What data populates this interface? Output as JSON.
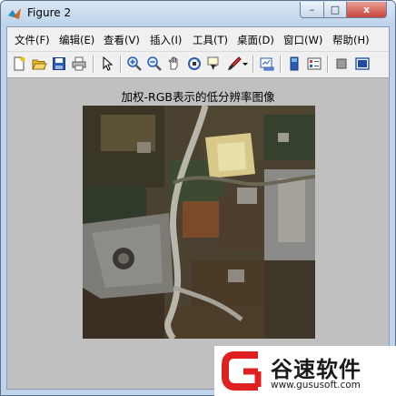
{
  "window": {
    "title": "Figure 2",
    "controls": {
      "minimize": "–",
      "maximize": "□",
      "close": "x"
    }
  },
  "menu": [
    {
      "label": "文件(F)"
    },
    {
      "label": "编辑(E)"
    },
    {
      "label": "查看(V)"
    },
    {
      "label": "插入(I)"
    },
    {
      "label": "工具(T)"
    },
    {
      "label": "桌面(D)"
    },
    {
      "label": "窗口(W)"
    },
    {
      "label": "帮助(H)"
    }
  ],
  "toolbar": [
    {
      "icon": "new-figure-icon"
    },
    {
      "icon": "open-file-icon"
    },
    {
      "icon": "save-figure-icon"
    },
    {
      "icon": "print-figure-icon"
    },
    {
      "icon": "edit-plot-icon"
    },
    {
      "icon": "zoom-in-icon"
    },
    {
      "icon": "zoom-out-icon"
    },
    {
      "icon": "pan-icon"
    },
    {
      "icon": "rotate-3d-icon"
    },
    {
      "icon": "data-cursor-icon"
    },
    {
      "icon": "brush-icon"
    },
    {
      "icon": "link-plot-icon"
    },
    {
      "icon": "insert-colorbar-icon"
    },
    {
      "icon": "insert-legend-icon"
    },
    {
      "icon": "hide-plot-tools-icon"
    },
    {
      "icon": "show-plot-tools-icon"
    }
  ],
  "figure": {
    "axes_title": "加权-RGB表示的低分辨率图像",
    "background_color": "#c0c0c0"
  },
  "watermark": {
    "name": "谷速软件",
    "url": "www.gususoft.com",
    "logo_color": "#e02020"
  }
}
